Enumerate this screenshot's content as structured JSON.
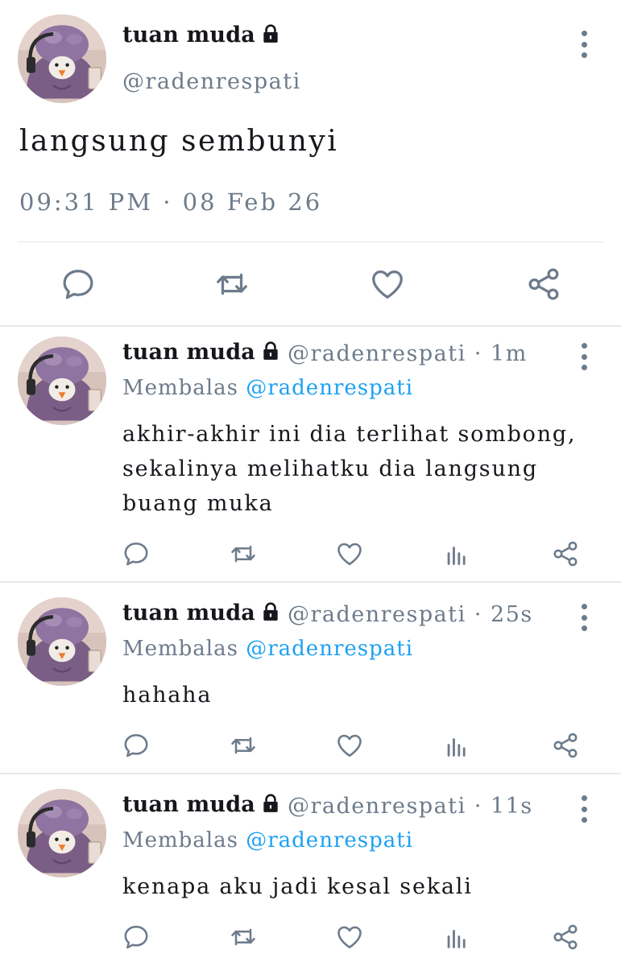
{
  "main_tweet": {
    "author_name": "tuan muda",
    "handle": "@radenrespati",
    "text": "langsung sembunyi",
    "timestamp": "09:31 PM · 08 Feb 26"
  },
  "replies": [
    {
      "author_name": "tuan muda",
      "meta": "@radenrespati · 1m",
      "reply_prefix": "Membalas ",
      "reply_to": "@radenrespati",
      "text": "akhir-akhir ini dia terlihat sombong,\nsekalinya melihatku dia langsung\nbuang muka"
    },
    {
      "author_name": "tuan muda",
      "meta": "@radenrespati · 25s",
      "reply_prefix": "Membalas ",
      "reply_to": "@radenrespati",
      "text": "hahaha"
    },
    {
      "author_name": "tuan muda",
      "meta": "@radenrespati · 11s",
      "reply_prefix": "Membalas ",
      "reply_to": "@radenrespati",
      "text": "kenapa aku jadi kesal sekali"
    }
  ],
  "icons": {
    "reply": "speech-bubble-icon",
    "retweet": "retweet-arrows-icon",
    "like": "heart-icon",
    "views": "bar-chart-icon",
    "share": "share-nodes-icon",
    "lock": "lock-icon",
    "more": "vertical-dots-icon"
  },
  "colors": {
    "mention": "#1da1f2",
    "muted": "#6d7b8b",
    "text": "#16161c"
  }
}
